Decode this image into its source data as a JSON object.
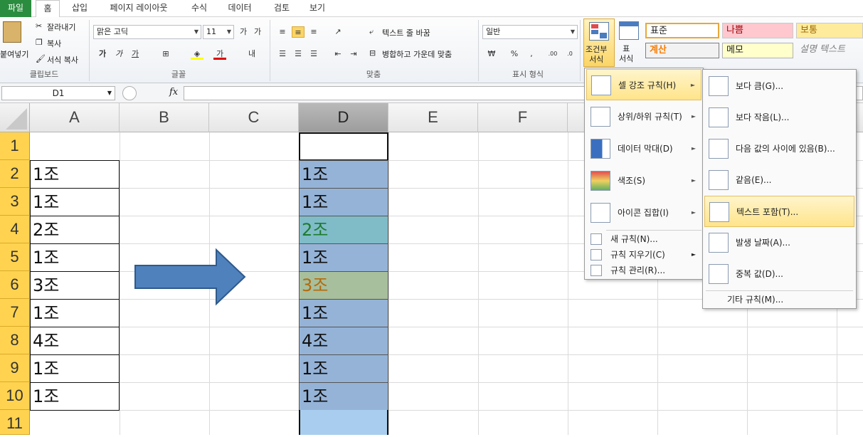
{
  "tabs": [
    "파일",
    "홈",
    "삽입",
    "페이지 레이아웃",
    "수식",
    "데이터",
    "검토",
    "보기"
  ],
  "clipboard": {
    "paste": "붙여넣기",
    "cut": "잘라내기",
    "copy": "복사",
    "format_painter": "서식 복사",
    "label": "클립보드"
  },
  "font": {
    "name": "맑은 고딕",
    "size": "11",
    "label": "글꼴"
  },
  "alignment": {
    "wrap": "텍스트 줄 바꿈",
    "merge": "병합하고 가운데 맞춤",
    "label": "맞춤"
  },
  "number": {
    "format": "일반",
    "label": "표시 형식"
  },
  "styles_group": {
    "conditional": "조건부\n서식",
    "table": "표\n서식"
  },
  "styles": {
    "normal": "표준",
    "bad": "나쁨",
    "neutral": "보통",
    "calc": "계산",
    "memo": "메모",
    "explain": "설명 텍스트"
  },
  "namebox": "D1",
  "fx": "fx",
  "columns": [
    "A",
    "B",
    "C",
    "D",
    "E",
    "F"
  ],
  "rows": [
    "1",
    "2",
    "3",
    "4",
    "5",
    "6",
    "7",
    "8",
    "9",
    "10",
    "11"
  ],
  "col_a": [
    "",
    "1조",
    "1조",
    "2조",
    "1조",
    "3조",
    "1조",
    "4조",
    "1조",
    "1조"
  ],
  "col_d": [
    "",
    "1조",
    "1조",
    "2조",
    "1조",
    "3조",
    "1조",
    "4조",
    "1조",
    "1조",
    ""
  ],
  "menu": {
    "items": [
      "셀 강조 규칙(H)",
      "상위/하위 규칙(T)",
      "데이터 막대(D)",
      "색조(S)",
      "아이콘 집합(I)"
    ],
    "small_items": [
      "새 규칙(N)...",
      "규칙 지우기(C)",
      "규칙 관리(R)..."
    ]
  },
  "submenu": {
    "items": [
      "보다 큼(G)...",
      "보다 작음(L)...",
      "다음 값의 사이에 있음(B)...",
      "같음(E)...",
      "텍스트 포함(T)...",
      "발생 날짜(A)...",
      "중복 값(D)..."
    ],
    "more": "기타 규칙(M)..."
  },
  "colors": {
    "row_header": "#ffd34f",
    "cell_blue": "#95b3d7",
    "cell_green": "#7fbcc8",
    "cell_olive": "#a7bf9d",
    "text_green": "#1e7b2e",
    "text_orange": "#b46a0a",
    "arrow": "#4f81bd",
    "menu_highlight": "#ffe48a"
  }
}
